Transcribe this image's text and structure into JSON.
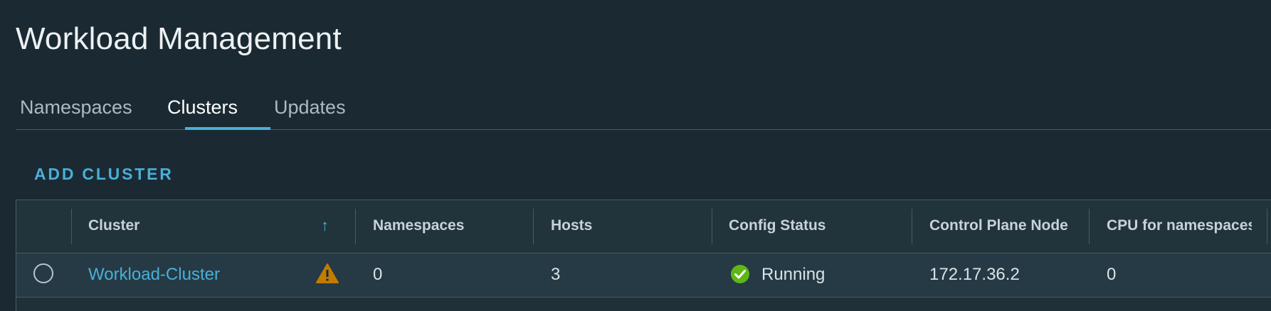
{
  "page": {
    "title": "Workload Management"
  },
  "tabs": [
    {
      "label": "Namespaces",
      "active": false
    },
    {
      "label": "Clusters",
      "active": true
    },
    {
      "label": "Updates",
      "active": false
    }
  ],
  "actions": {
    "add_cluster": "ADD CLUSTER"
  },
  "grid": {
    "sort_column": "Cluster",
    "sort_direction": "ascending",
    "columns": [
      "Cluster",
      "Namespaces",
      "Hosts",
      "Config Status",
      "Control Plane Node",
      "CPU for namespaces"
    ],
    "rows": [
      {
        "cluster": "Workload-Cluster",
        "warning": true,
        "namespaces": "0",
        "hosts": "3",
        "config_status": "Running",
        "config_status_icon": "check-circle-icon",
        "control_plane_node": "172.17.36.2",
        "cpu_for_namespaces": "0"
      }
    ]
  },
  "colors": {
    "background": "#1b2a32",
    "accent": "#49afd9",
    "warning": "#c27b00",
    "success": "#5eb715"
  }
}
